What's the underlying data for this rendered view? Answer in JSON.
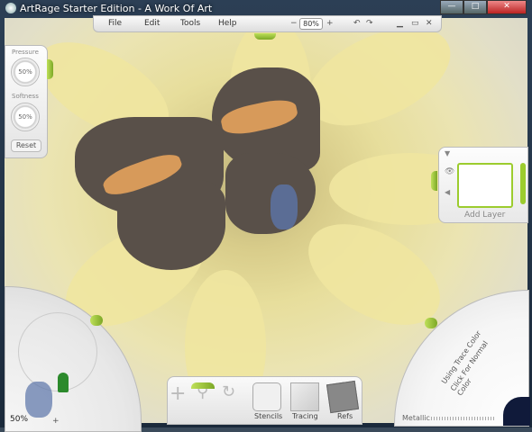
{
  "window": {
    "title": "ArtRage Starter Edition - A Work Of Art",
    "min": "—",
    "max": "□",
    "close": "✕"
  },
  "menu": {
    "items": [
      "File",
      "Edit",
      "Tools",
      "Help"
    ],
    "zoom_minus": "−",
    "zoom": "80%",
    "zoom_plus": "+"
  },
  "settings": {
    "pressure_label": "Pressure",
    "pressure": "50%",
    "softness_label": "Softness",
    "softness": "50%",
    "reset": "Reset"
  },
  "layers": {
    "add_layer": "Add Layer"
  },
  "tools": {
    "zoom": "50%"
  },
  "colorpicker": {
    "line1": "Using Trace Color",
    "line2": "Click For Normal Color",
    "finish": "Metallic"
  },
  "bottom": {
    "stencils": "Stencils",
    "tracing": "Tracing",
    "refs": "Refs"
  }
}
